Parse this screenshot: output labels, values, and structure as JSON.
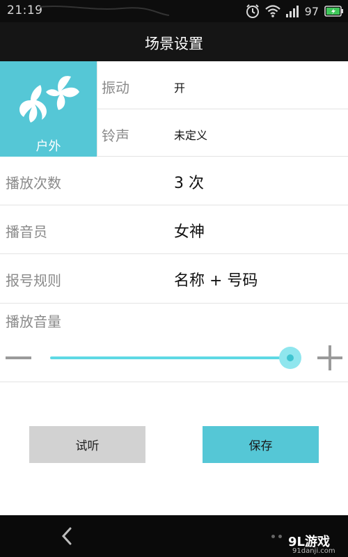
{
  "status_bar": {
    "time": "21:19",
    "battery_level": "97",
    "icons": [
      "alarm-icon",
      "wifi-icon",
      "signal-icon",
      "battery-icon"
    ]
  },
  "header": {
    "title": "场景设置"
  },
  "scene": {
    "label": "户外",
    "icon": "butterfly-icon",
    "color": "#55c7d6"
  },
  "settings": {
    "vibration": {
      "label": "振动",
      "value": "开"
    },
    "ringtone": {
      "label": "铃声",
      "value": "未定义"
    },
    "play_count": {
      "label": "播放次数",
      "value": "3 次"
    },
    "announcer": {
      "label": "播音员",
      "value": "女神"
    },
    "number_rule": {
      "label": "报号规则",
      "value": "名称 + 号码"
    },
    "volume": {
      "label": "播放音量",
      "level_fraction": 1.0
    }
  },
  "buttons": {
    "test_label": "试听",
    "save_label": "保存"
  },
  "watermark": {
    "main": "9L游戏",
    "sub": "91danji.com"
  },
  "colors": {
    "accent": "#55c7d6",
    "slider": "#5ed9e4",
    "button_gray": "#d2d2d2"
  }
}
